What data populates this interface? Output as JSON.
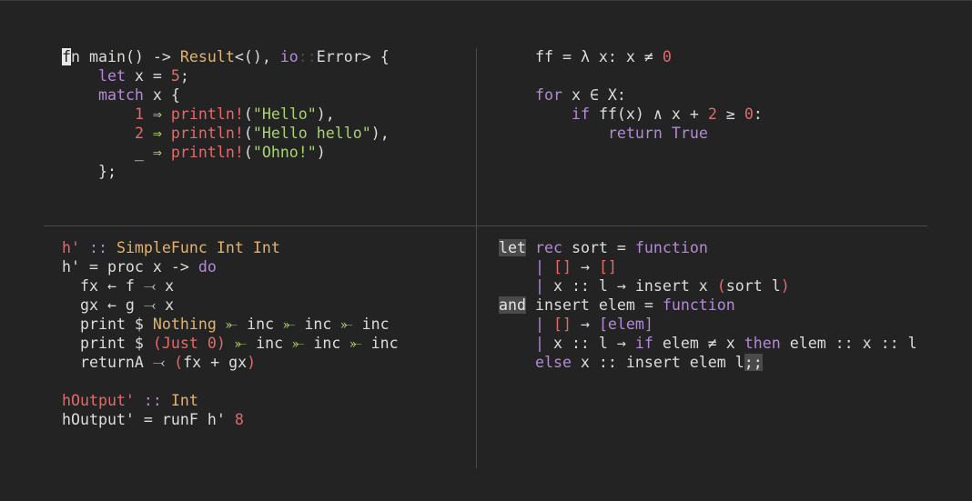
{
  "colors": {
    "background": "#232323",
    "text": "#dcdcdc",
    "keyword": "#b48ad8",
    "type": "#e3b36a",
    "number": "#e26a6a",
    "string": "#a9d46b",
    "function": "#e26a6a",
    "operator": "#a9d46b",
    "boolean": "#b48ad8",
    "namespace": "#b48ad8",
    "divider": "#4a4a4a"
  },
  "panes": [
    {
      "id": "rust",
      "lines": [
        [
          {
            "t": "f",
            "c": "cursor"
          },
          {
            "t": "n main() -> ",
            "c": "text"
          },
          {
            "t": "Result",
            "c": "type"
          },
          {
            "t": "<(), ",
            "c": "text"
          },
          {
            "t": "io",
            "c": "keyword"
          },
          {
            "t": "::",
            "c": "divider"
          },
          {
            "t": "Error> {",
            "c": "text"
          }
        ],
        [
          {
            "t": "    ",
            "c": "text"
          },
          {
            "t": "let",
            "c": "keyword"
          },
          {
            "t": " x = ",
            "c": "text"
          },
          {
            "t": "5",
            "c": "number"
          },
          {
            "t": ";",
            "c": "text"
          }
        ],
        [
          {
            "t": "    ",
            "c": "text"
          },
          {
            "t": "match",
            "c": "keyword"
          },
          {
            "t": " x {",
            "c": "text"
          }
        ],
        [
          {
            "t": "        ",
            "c": "text"
          },
          {
            "t": "1",
            "c": "number"
          },
          {
            "t": " ⇒ ",
            "c": "string"
          },
          {
            "t": "println!",
            "c": "function"
          },
          {
            "t": "(",
            "c": "text"
          },
          {
            "t": "\"Hello\"",
            "c": "string"
          },
          {
            "t": "),",
            "c": "text"
          }
        ],
        [
          {
            "t": "        ",
            "c": "text"
          },
          {
            "t": "2",
            "c": "number"
          },
          {
            "t": " ⇒ ",
            "c": "string"
          },
          {
            "t": "println!",
            "c": "function"
          },
          {
            "t": "(",
            "c": "text"
          },
          {
            "t": "\"Hello hello\"",
            "c": "string"
          },
          {
            "t": "),",
            "c": "text"
          }
        ],
        [
          {
            "t": "        _",
            "c": "text"
          },
          {
            "t": " ⇒ ",
            "c": "string"
          },
          {
            "t": "println!",
            "c": "function"
          },
          {
            "t": "(",
            "c": "text"
          },
          {
            "t": "\"Ohno!\"",
            "c": "string"
          },
          {
            "t": ")",
            "c": "text"
          }
        ],
        [
          {
            "t": "    };",
            "c": "text"
          }
        ]
      ]
    },
    {
      "id": "python",
      "lines": [
        [
          {
            "t": "ff = λ x: x ≠ ",
            "c": "text"
          },
          {
            "t": "0",
            "c": "number"
          }
        ],
        [
          {
            "t": "",
            "c": "text"
          }
        ],
        [
          {
            "t": "for",
            "c": "keyword"
          },
          {
            "t": " x ∈ X:",
            "c": "text"
          }
        ],
        [
          {
            "t": "    ",
            "c": "text"
          },
          {
            "t": "if",
            "c": "keyword"
          },
          {
            "t": " ff(x) ∧ x + ",
            "c": "text"
          },
          {
            "t": "2",
            "c": "number"
          },
          {
            "t": " ≥ ",
            "c": "text"
          },
          {
            "t": "0",
            "c": "number"
          },
          {
            "t": ":",
            "c": "text"
          }
        ],
        [
          {
            "t": "        ",
            "c": "text"
          },
          {
            "t": "return",
            "c": "keyword"
          },
          {
            "t": " ",
            "c": "text"
          },
          {
            "t": "True",
            "c": "boolean"
          }
        ]
      ]
    },
    {
      "id": "haskell",
      "lines": [
        [
          {
            "t": "h'",
            "c": "number"
          },
          {
            "t": " :: ",
            "c": "keyword"
          },
          {
            "t": "SimpleFunc",
            "c": "type"
          },
          {
            "t": " ",
            "c": "text"
          },
          {
            "t": "Int",
            "c": "type"
          },
          {
            "t": " ",
            "c": "text"
          },
          {
            "t": "Int",
            "c": "type"
          }
        ],
        [
          {
            "t": "h' = proc x -> ",
            "c": "text"
          },
          {
            "t": "do",
            "c": "keyword"
          }
        ],
        [
          {
            "t": "  fx ← f ⤙ x",
            "c": "text"
          }
        ],
        [
          {
            "t": "  gx ← g ⤙ x",
            "c": "text"
          }
        ],
        [
          {
            "t": "  print $ ",
            "c": "text"
          },
          {
            "t": "Nothing",
            "c": "type"
          },
          {
            "t": " ⤜ ",
            "c": "string"
          },
          {
            "t": "inc",
            "c": "text"
          },
          {
            "t": " ⤜ ",
            "c": "string"
          },
          {
            "t": "inc",
            "c": "text"
          },
          {
            "t": " ⤜ ",
            "c": "string"
          },
          {
            "t": "inc",
            "c": "text"
          }
        ],
        [
          {
            "t": "  print $ ",
            "c": "text"
          },
          {
            "t": "(Just ",
            "c": "function"
          },
          {
            "t": "0",
            "c": "number"
          },
          {
            "t": ")",
            "c": "function"
          },
          {
            "t": " ⤜ ",
            "c": "string"
          },
          {
            "t": "inc",
            "c": "text"
          },
          {
            "t": " ⤜ ",
            "c": "string"
          },
          {
            "t": "inc",
            "c": "text"
          },
          {
            "t": " ⤜ ",
            "c": "string"
          },
          {
            "t": "inc",
            "c": "text"
          }
        ],
        [
          {
            "t": "  returnA ⤙ ",
            "c": "text"
          },
          {
            "t": "(",
            "c": "function"
          },
          {
            "t": "fx + gx",
            "c": "text"
          },
          {
            "t": ")",
            "c": "function"
          }
        ],
        [
          {
            "t": "",
            "c": "text"
          }
        ],
        [
          {
            "t": "hOutput'",
            "c": "number"
          },
          {
            "t": " :: ",
            "c": "keyword"
          },
          {
            "t": "Int",
            "c": "type"
          }
        ],
        [
          {
            "t": "hOutput' = runF h' ",
            "c": "text"
          },
          {
            "t": "8",
            "c": "number"
          }
        ]
      ]
    },
    {
      "id": "ocaml",
      "lines": [
        [
          {
            "t": "let",
            "c": "hl"
          },
          {
            "t": " ",
            "c": "text"
          },
          {
            "t": "rec",
            "c": "keyword"
          },
          {
            "t": " sort = ",
            "c": "text"
          },
          {
            "t": "function",
            "c": "keyword"
          }
        ],
        [
          {
            "t": "    ",
            "c": "text"
          },
          {
            "t": "|",
            "c": "keyword"
          },
          {
            "t": " ",
            "c": "text"
          },
          {
            "t": "[]",
            "c": "number"
          },
          {
            "t": " → ",
            "c": "text"
          },
          {
            "t": "[]",
            "c": "number"
          }
        ],
        [
          {
            "t": "    ",
            "c": "text"
          },
          {
            "t": "|",
            "c": "keyword"
          },
          {
            "t": " x :: l → insert x ",
            "c": "text"
          },
          {
            "t": "(",
            "c": "function"
          },
          {
            "t": "sort l",
            "c": "text"
          },
          {
            "t": ")",
            "c": "function"
          }
        ],
        [
          {
            "t": "and",
            "c": "hl"
          },
          {
            "t": " insert elem = ",
            "c": "text"
          },
          {
            "t": "function",
            "c": "keyword"
          }
        ],
        [
          {
            "t": "    ",
            "c": "text"
          },
          {
            "t": "|",
            "c": "keyword"
          },
          {
            "t": " ",
            "c": "text"
          },
          {
            "t": "[]",
            "c": "number"
          },
          {
            "t": " → ",
            "c": "text"
          },
          {
            "t": "[elem]",
            "c": "keyword"
          }
        ],
        [
          {
            "t": "    ",
            "c": "text"
          },
          {
            "t": "|",
            "c": "keyword"
          },
          {
            "t": " x :: l → ",
            "c": "text"
          },
          {
            "t": "if",
            "c": "keyword"
          },
          {
            "t": " elem ≠ x ",
            "c": "text"
          },
          {
            "t": "then",
            "c": "keyword"
          },
          {
            "t": " elem :: x :: l",
            "c": "text"
          }
        ],
        [
          {
            "t": "    ",
            "c": "text"
          },
          {
            "t": "else",
            "c": "keyword"
          },
          {
            "t": " x :: insert elem l",
            "c": "text"
          },
          {
            "t": ";;",
            "c": "hl"
          }
        ]
      ]
    }
  ]
}
